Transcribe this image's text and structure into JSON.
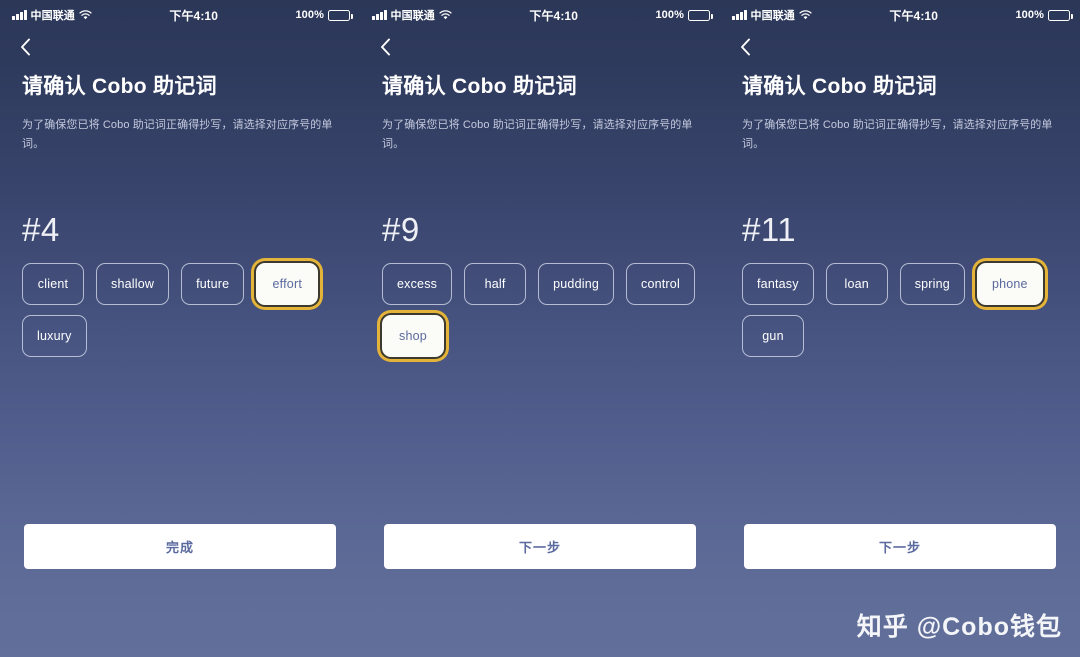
{
  "status_bar": {
    "carrier": "中国联通",
    "time": "下午4:10",
    "battery_percent": "100%",
    "signal_icon": "signal-bars-icon",
    "wifi_icon": "wifi-icon",
    "battery_icon": "battery-full-icon"
  },
  "nav": {
    "back_icon": "back-chevron-icon"
  },
  "page": {
    "title": "请确认 Cobo 助记词",
    "subtitle": "为了确保您已将 Cobo 助记词正确得抄写，请选择对应序号的单词。"
  },
  "watermark": "知乎 @Cobo钱包",
  "colors": {
    "bg_top": "#2c3758",
    "bg_bottom": "#626f9b",
    "highlight_gold": "#e3b33a",
    "chip_selected_bg": "#fbfbf7",
    "chip_selected_text": "#5a6a9e",
    "action_bg": "#ffffff",
    "action_text": "#5a6a9e",
    "subtitle_text": "#c3c9dd"
  },
  "panels": [
    {
      "index_label": "#4",
      "words": [
        {
          "label": "client",
          "selected": false
        },
        {
          "label": "shallow",
          "selected": false
        },
        {
          "label": "future",
          "selected": false
        },
        {
          "label": "effort",
          "selected": true
        },
        {
          "label": "luxury",
          "selected": false
        }
      ],
      "action_label": "完成"
    },
    {
      "index_label": "#9",
      "words": [
        {
          "label": "excess",
          "selected": false
        },
        {
          "label": "half",
          "selected": false
        },
        {
          "label": "pudding",
          "selected": false
        },
        {
          "label": "control",
          "selected": false
        },
        {
          "label": "shop",
          "selected": true
        }
      ],
      "action_label": "下一步"
    },
    {
      "index_label": "#11",
      "words": [
        {
          "label": "fantasy",
          "selected": false
        },
        {
          "label": "loan",
          "selected": false
        },
        {
          "label": "spring",
          "selected": false
        },
        {
          "label": "phone",
          "selected": true
        },
        {
          "label": "gun",
          "selected": false
        }
      ],
      "action_label": "下一步"
    }
  ]
}
